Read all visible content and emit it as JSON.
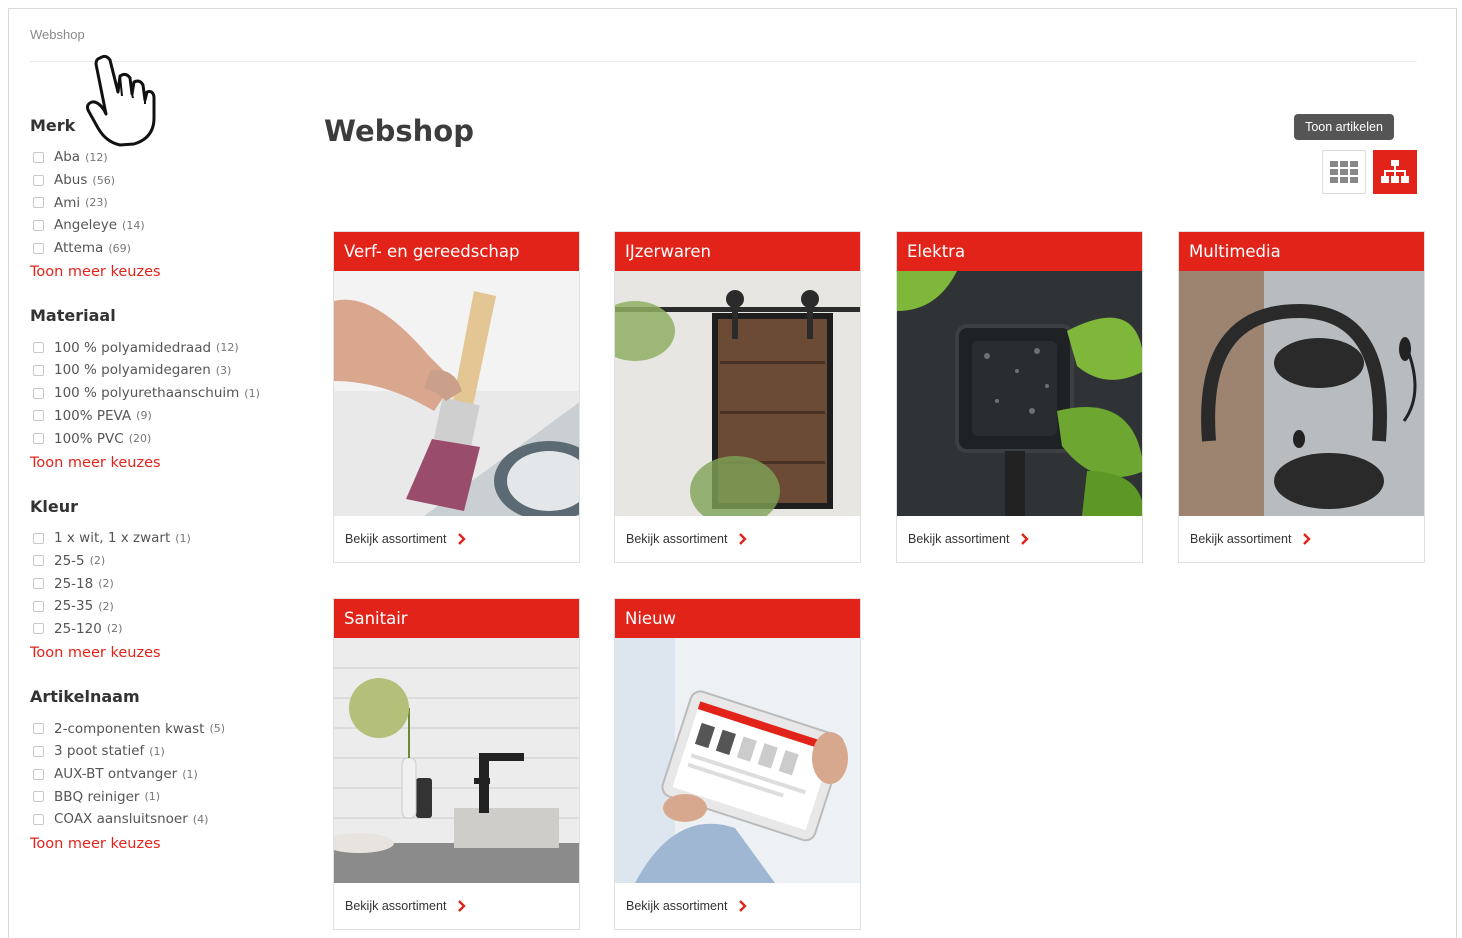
{
  "breadcrumb": "Webshop",
  "page_title": "Webshop",
  "tooltip": "Toon artikelen",
  "colors": {
    "accent": "#e2231a"
  },
  "filters": [
    {
      "title": "Merk",
      "items": [
        {
          "label": "Aba",
          "count": "(12)"
        },
        {
          "label": "Abus",
          "count": "(56)"
        },
        {
          "label": "Ami",
          "count": "(23)"
        },
        {
          "label": "Angeleye",
          "count": "(14)"
        },
        {
          "label": "Attema",
          "count": "(69)"
        }
      ],
      "more": "Toon meer keuzes"
    },
    {
      "title": "Materiaal",
      "items": [
        {
          "label": "100 % polyamidedraad",
          "count": "(12)"
        },
        {
          "label": "100 % polyamidegaren",
          "count": "(3)"
        },
        {
          "label": "100 % polyurethaanschuim",
          "count": "(1)"
        },
        {
          "label": "100% PEVA",
          "count": "(9)"
        },
        {
          "label": "100% PVC",
          "count": "(20)"
        }
      ],
      "more": "Toon meer keuzes"
    },
    {
      "title": "Kleur",
      "items": [
        {
          "label": "1 x wit, 1 x zwart",
          "count": "(1)"
        },
        {
          "label": "25-5",
          "count": "(2)"
        },
        {
          "label": "25-18",
          "count": "(2)"
        },
        {
          "label": "25-35",
          "count": "(2)"
        },
        {
          "label": "25-120",
          "count": "(2)"
        }
      ],
      "more": "Toon meer keuzes"
    },
    {
      "title": "Artikelnaam",
      "items": [
        {
          "label": "2-componenten kwast",
          "count": "(5)"
        },
        {
          "label": "3 poot statief",
          "count": "(1)"
        },
        {
          "label": "AUX-BT ontvanger",
          "count": "(1)"
        },
        {
          "label": "BBQ reiniger",
          "count": "(1)"
        },
        {
          "label": "COAX aansluitsnoer",
          "count": "(4)"
        }
      ],
      "more": "Toon meer keuzes"
    }
  ],
  "categories": [
    {
      "title": "Verf- en gereedschap",
      "link": "Bekijk assortiment"
    },
    {
      "title": "IJzerwaren",
      "link": "Bekijk assortiment"
    },
    {
      "title": "Elektra",
      "link": "Bekijk assortiment"
    },
    {
      "title": "Multimedia",
      "link": "Bekijk assortiment"
    },
    {
      "title": "Sanitair",
      "link": "Bekijk assortiment"
    },
    {
      "title": "Nieuw",
      "link": "Bekijk assortiment"
    }
  ],
  "icons": {
    "cursor": "hand-pointer-icon",
    "grid_view": "grid-view-icon",
    "tree_view": "sitemap-icon",
    "link_arrow": "chevron-right-icon"
  }
}
